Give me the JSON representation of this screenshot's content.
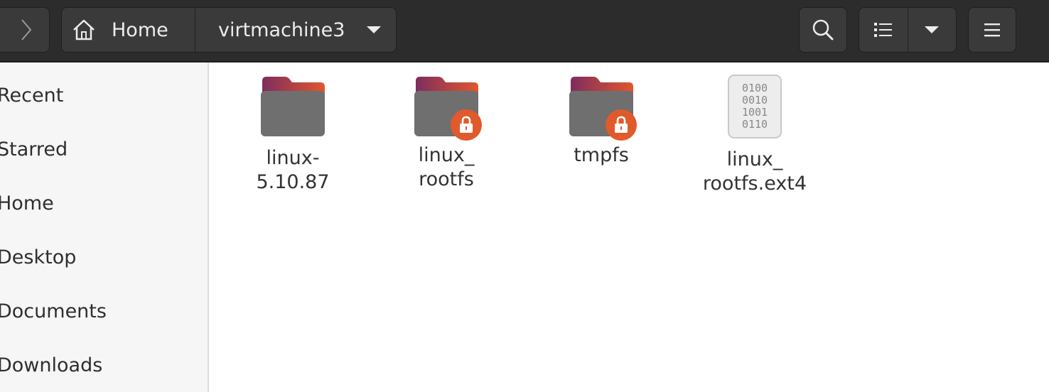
{
  "header": {
    "pathbar": {
      "home_label": "Home",
      "current_label": "virtmachine3"
    }
  },
  "sidebar": {
    "items": [
      {
        "label": "Recent"
      },
      {
        "label": "Starred"
      },
      {
        "label": "Home"
      },
      {
        "label": "Desktop"
      },
      {
        "label": "Documents"
      },
      {
        "label": "Downloads"
      }
    ]
  },
  "files": [
    {
      "line1": "linux-",
      "line2": "5.10.87",
      "icon": "folder-icon",
      "locked": false
    },
    {
      "line1": "linux_",
      "line2": "rootfs",
      "icon": "folder-icon",
      "locked": true
    },
    {
      "line1": "tmpfs",
      "line2": "",
      "icon": "folder-icon",
      "locked": true
    },
    {
      "line1": "linux_",
      "line2": "rootfs.ext4",
      "icon": "binary-file-icon",
      "locked": false
    }
  ],
  "binary_icon_text": [
    "0100",
    "0010",
    "1001",
    "0110"
  ],
  "colors": {
    "folder_top": "#7e2d5e",
    "folder_body": "#6f6f6f",
    "lock_badge": "#e05a2c",
    "header_bg": "#2c2c2c"
  }
}
